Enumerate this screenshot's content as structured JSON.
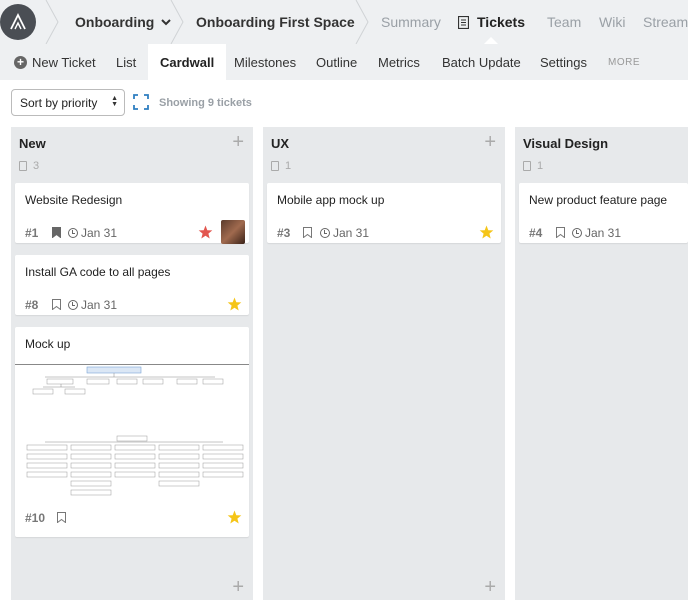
{
  "topbar": {
    "logo": "assembla-logo-icon",
    "breadcrumbs": [
      "Onboarding",
      "Onboarding First Space"
    ],
    "nav": [
      "Summary",
      "Tickets",
      "Team",
      "Wiki",
      "Stream"
    ],
    "active_nav": "Tickets"
  },
  "subbar": {
    "new_ticket": "New Ticket",
    "tabs": [
      "List",
      "Cardwall",
      "Milestones",
      "Outline",
      "Metrics",
      "Batch Update",
      "Settings"
    ],
    "active_tab": "Cardwall",
    "more": "MORE"
  },
  "toolbar": {
    "sort_value": "Sort by priority",
    "showing": "Showing 9 tickets"
  },
  "colors": {
    "star_gold": "#f5c518",
    "star_red": "#e2564f",
    "column_bg": "#e7e9eb",
    "topbar_bg": "#eef0f2"
  },
  "columns": [
    {
      "title": "New",
      "count": "3",
      "cards": [
        {
          "title": "Website Redesign",
          "num": "#1",
          "due": "Jan 31",
          "bookmark": "filled",
          "star": "red",
          "avatar": true
        },
        {
          "title": "Install GA code to all pages",
          "num": "#8",
          "due": "Jan 31",
          "bookmark": "outline",
          "star": "gold"
        },
        {
          "title": "Mock up",
          "num": "#10",
          "bookmark": "outline",
          "star": "gold",
          "attachment": "sitemap-wireframe-image"
        }
      ]
    },
    {
      "title": "UX",
      "count": "1",
      "cards": [
        {
          "title": "Mobile app mock up",
          "num": "#3",
          "due": "Jan 31",
          "bookmark": "outline",
          "star": "gold"
        }
      ]
    },
    {
      "title": "Visual Design",
      "count": "1",
      "cards": [
        {
          "title": "New product feature page",
          "num": "#4",
          "due": "Jan 31",
          "bookmark": "outline"
        }
      ]
    }
  ]
}
